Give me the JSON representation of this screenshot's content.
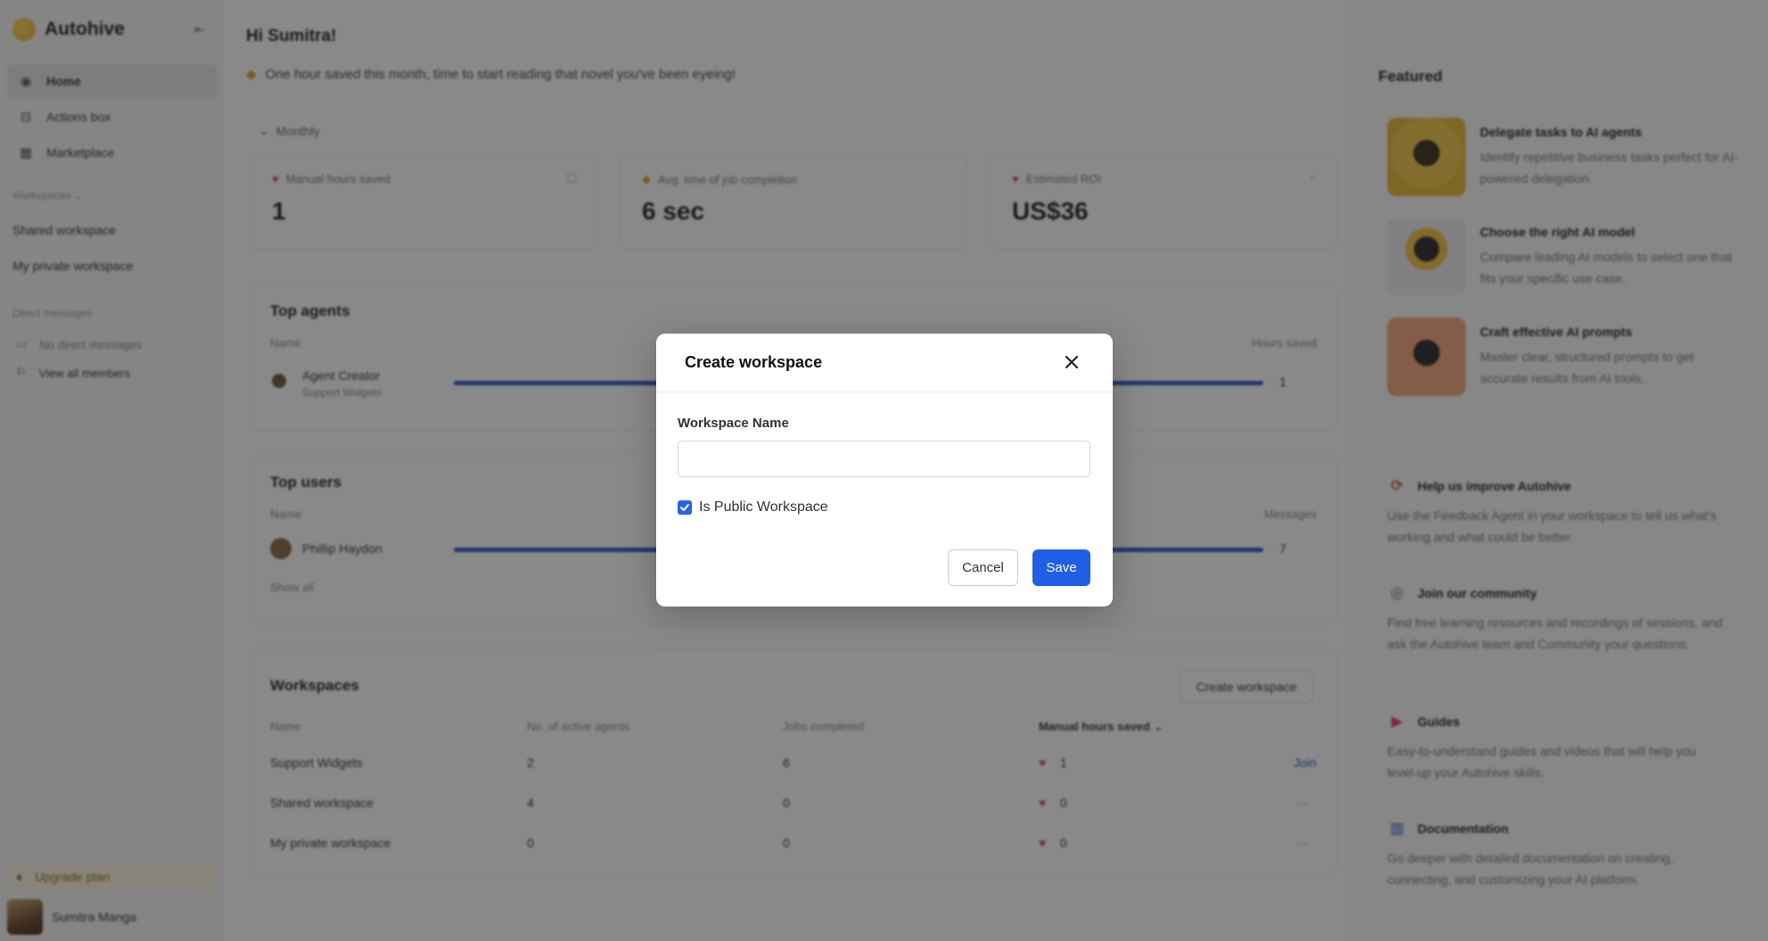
{
  "sidebar": {
    "brand": "Autohive",
    "nav": [
      {
        "label": "Home",
        "icon": "home-icon"
      },
      {
        "label": "Actions box",
        "icon": "inbox-icon"
      },
      {
        "label": "Marketplace",
        "icon": "grid-icon"
      }
    ],
    "workspaces_label": "Workspaces ⌄",
    "workspaces": [
      "Shared workspace",
      "My private workspace"
    ],
    "direct_messages_label": "Direct messages",
    "no_direct_messages": "No direct messages",
    "view_all_members": "View all members",
    "upgrade": "Upgrade plan",
    "user_name": "Sumitra Manga"
  },
  "main": {
    "greeting": "Hi Sumitra!",
    "subgreeting": "One hour saved this month, time to start reading that novel you've been eyeing!",
    "period": "Monthly",
    "stats": [
      {
        "label": "Manual hours saved",
        "value": "1"
      },
      {
        "label": "Avg. time of job completion",
        "value": "6 sec"
      },
      {
        "label": "Estimated ROI",
        "value": "US$36"
      }
    ],
    "top_agents": {
      "title": "Top agents",
      "col_name": "Name",
      "col_value": "Hours saved",
      "rows": [
        {
          "name": "Agent Creator",
          "sub": "Support Widgets",
          "value": "1",
          "fraction": 1.0
        }
      ]
    },
    "top_users": {
      "title": "Top users",
      "col_name": "Name",
      "col_value": "Messages",
      "rows": [
        {
          "name": "Phillip Haydon",
          "value": "7",
          "fraction": 1.0
        }
      ],
      "show_all": "Show all"
    },
    "workspaces": {
      "title": "Workspaces",
      "create_button": "Create workspace",
      "headers": [
        "Name",
        "No. of active agents",
        "Jobs completed",
        "Manual hours saved"
      ],
      "rows": [
        {
          "name": "Support Widgets",
          "agents": "2",
          "jobs": "6",
          "hours": "1",
          "action": "Join"
        },
        {
          "name": "Shared workspace",
          "agents": "4",
          "jobs": "0",
          "hours": "0",
          "action": "···"
        },
        {
          "name": "My private workspace",
          "agents": "0",
          "jobs": "0",
          "hours": "0",
          "action": "···"
        }
      ]
    }
  },
  "right": {
    "featured_title": "Featured",
    "featured": [
      {
        "title": "Delegate tasks to AI agents",
        "desc": "Identify repetitive business tasks perfect for AI-powered delegation."
      },
      {
        "title": "Choose the right AI model",
        "desc": "Compare leading AI models to select one that fits your specific use case."
      },
      {
        "title": "Craft effective AI prompts",
        "desc": "Master clear, structured prompts to get accurate results from AI tools."
      }
    ],
    "resources": [
      {
        "title": "Help us improve Autohive",
        "desc": "Use the Feedback Agent in your workspace to tell us what's working and what could be better.",
        "icon": "feedback-icon"
      },
      {
        "title": "Join our community",
        "desc": "Find free learning resources and recordings of sessions, and ask the Autohive team and Community your questions.",
        "icon": "globe-icon"
      },
      {
        "title": "Guides",
        "desc": "Easy-to-understand guides and videos that will help you level-up your Autohive skills.",
        "icon": "play-icon"
      },
      {
        "title": "Documentation",
        "desc": "Go deeper with detailed documentation on creating, connecting, and customizing your AI platform.",
        "icon": "book-icon"
      }
    ]
  },
  "modal": {
    "title": "Create workspace",
    "field_label": "Workspace Name",
    "field_value": "",
    "field_placeholder": "",
    "checkbox_label": "Is Public Workspace",
    "checkbox_checked": true,
    "cancel": "Cancel",
    "save": "Save"
  },
  "colors": {
    "accent": "#1f5fe6",
    "bar": "#2855c9",
    "overlay": "rgba(20,20,20,0.5)"
  }
}
